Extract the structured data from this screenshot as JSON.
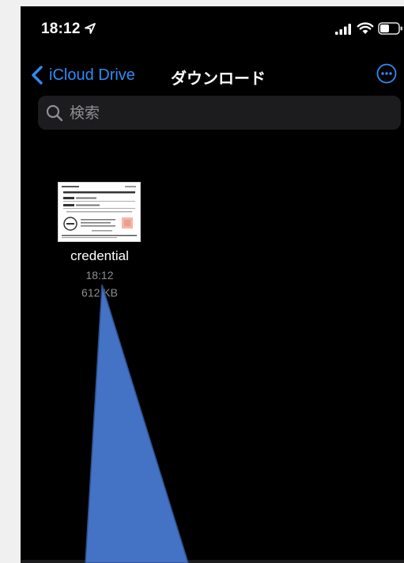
{
  "status_bar": {
    "time": "18:12",
    "icons": [
      "location-arrow-icon",
      "signal-icon",
      "wifi-icon",
      "battery-icon"
    ]
  },
  "nav": {
    "back_label": "iCloud Drive",
    "title": "ダウンロード",
    "more_icon": "ellipsis-circle-icon"
  },
  "search": {
    "placeholder": "検索",
    "value": ""
  },
  "files": [
    {
      "name": "credential",
      "time": "18:12",
      "size": "612 KB",
      "thumbnail": "document-preview"
    }
  ],
  "colors": {
    "accent": "#2f8bf5",
    "background": "#000000",
    "secondary_text": "#8e8e93",
    "search_bg": "#1c1c1e",
    "annotation": "#4472c4"
  }
}
